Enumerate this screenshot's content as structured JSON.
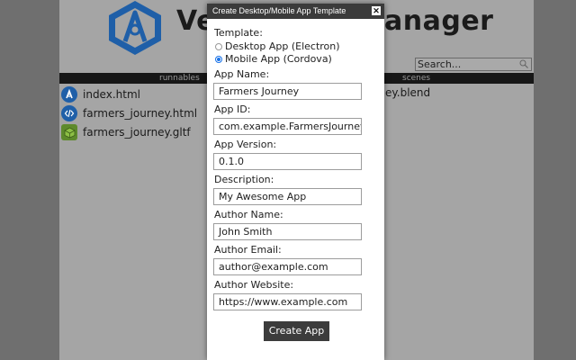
{
  "background": {
    "title_left": "Ve",
    "title_right": "anager",
    "search": {
      "placeholder": "Search..."
    },
    "columns": {
      "runnables": "runnables",
      "scenes": "scenes"
    },
    "files": [
      {
        "name": "index.html",
        "icon": "verge-logo-icon"
      },
      {
        "name": "farmers_journey.html",
        "icon": "code-file-icon"
      },
      {
        "name": "farmers_journey.gltf",
        "icon": "gltf-cube-icon"
      }
    ],
    "scene_partial": "ey.blend"
  },
  "modal": {
    "title": "Create Desktop/Mobile App Template",
    "close_label": "✕",
    "template_label": "Template:",
    "options": [
      {
        "label": "Desktop App (Electron)",
        "checked": false
      },
      {
        "label": "Mobile App (Cordova)",
        "checked": true
      }
    ],
    "fields": {
      "app_name": {
        "label": "App Name:",
        "value": "Farmers Journey"
      },
      "app_id": {
        "label": "App ID:",
        "value": "com.example.FarmersJourney"
      },
      "app_version": {
        "label": "App Version:",
        "value": "0.1.0"
      },
      "description": {
        "label": "Description:",
        "value": "My Awesome App"
      },
      "author_name": {
        "label": "Author Name:",
        "value": "John Smith"
      },
      "author_email": {
        "label": "Author Email:",
        "value": "author@example.com"
      },
      "author_website": {
        "label": "Author Website:",
        "value": "https://www.example.com"
      }
    },
    "submit_label": "Create App"
  },
  "colors": {
    "overlay": "#6f6f6f",
    "titlebar": "#3b3b3b",
    "button": "#3c3c3c",
    "radio_accent": "#1a73e8",
    "logo_blue": "#1f5fa8"
  }
}
